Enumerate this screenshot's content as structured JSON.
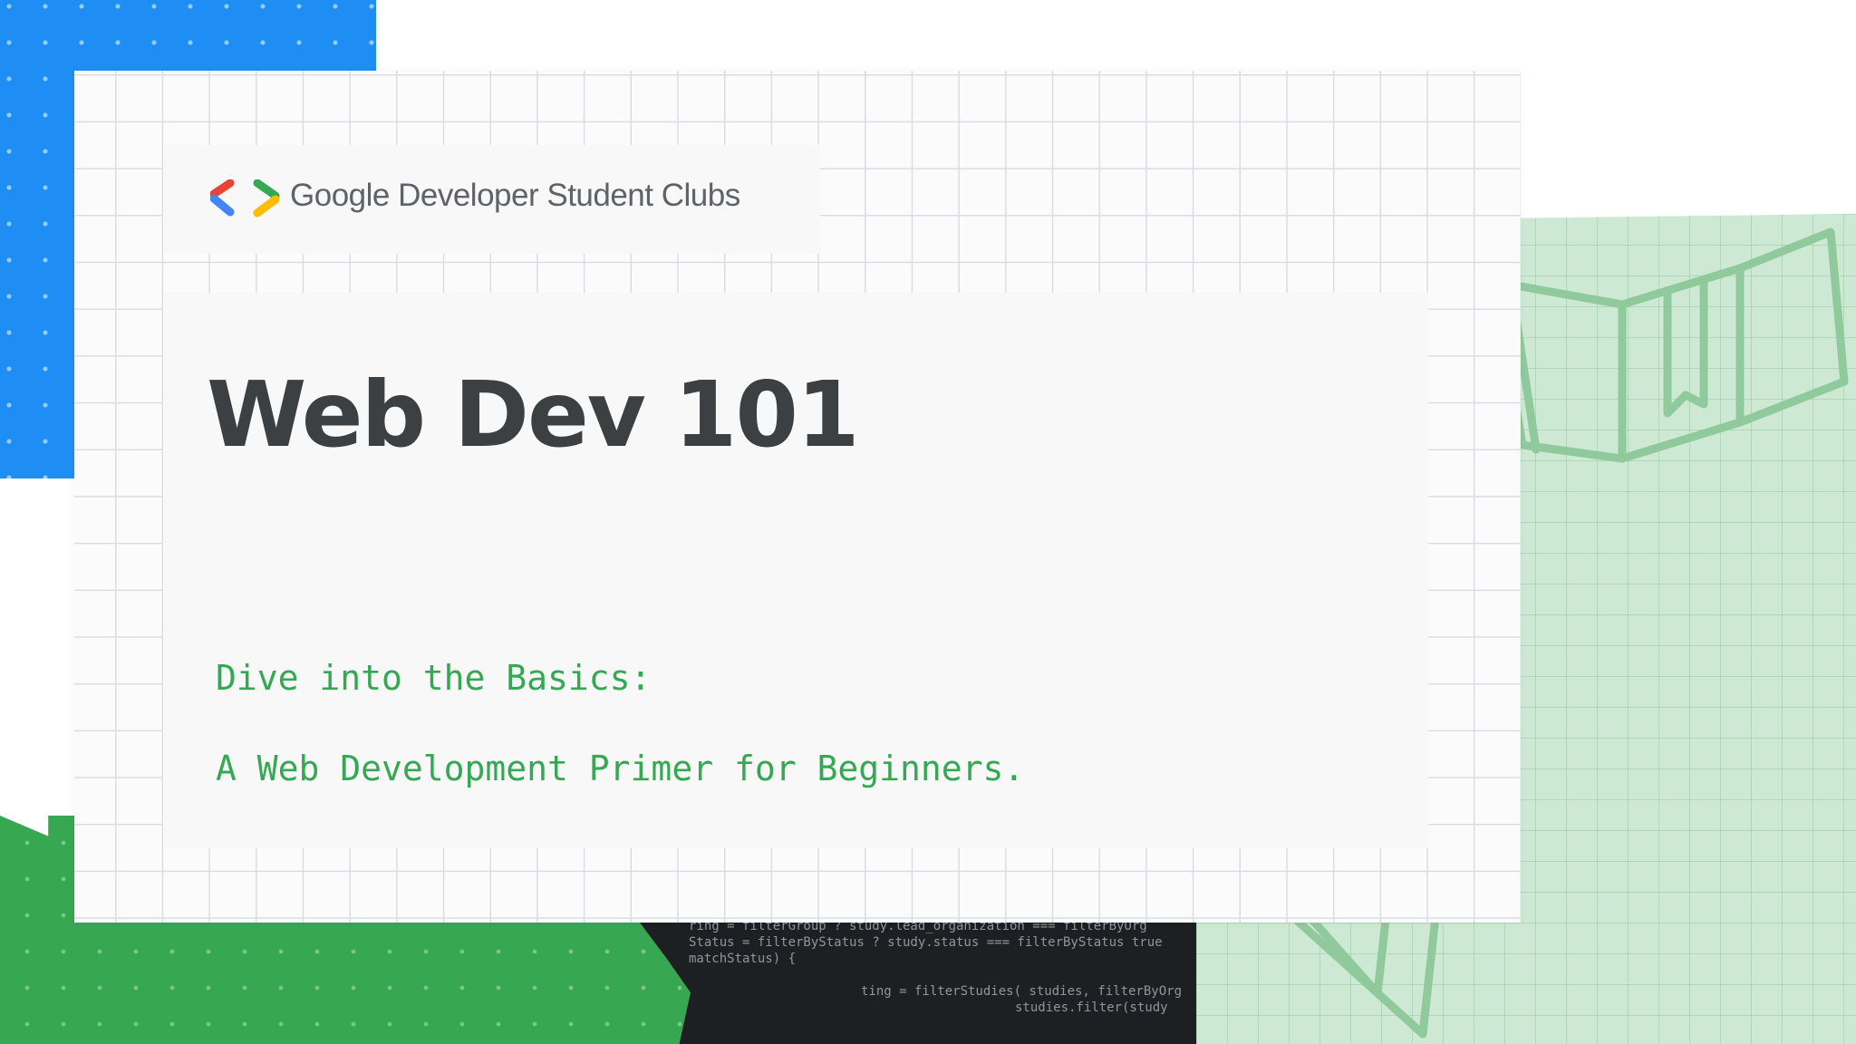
{
  "brand": {
    "name": "Google Developer Student Clubs",
    "logo": "gdsc-brackets-logo"
  },
  "slide": {
    "title": "Web Dev 101",
    "subtitle_line1": "Dive into the Basics:",
    "subtitle_line2": "A Web Development Primer for Beginners."
  },
  "colors": {
    "blue": "#1e8ef5",
    "green": "#37a752",
    "light_green": "#cde9d3",
    "title": "#3c4043",
    "subtitle": "#34a853",
    "logo_red": "#ea4335",
    "logo_blue": "#4285f4",
    "logo_green": "#34a853",
    "logo_yellow": "#fbbc04"
  },
  "decorations": {
    "code_text": [
      "ring = filterGroup ? study.lead_organization === filterByOrg",
      "Status = filterByStatus ? study.status === filterByStatus   true",
      "matchStatus) {",
      "",
      "ting = filterStudies( studies, filterByOrg",
      "studies.filter(study"
    ],
    "doodle_icons": [
      "open-book-icon",
      "globe-icon",
      "apple-icon",
      "triangle-ruler-icon"
    ]
  }
}
